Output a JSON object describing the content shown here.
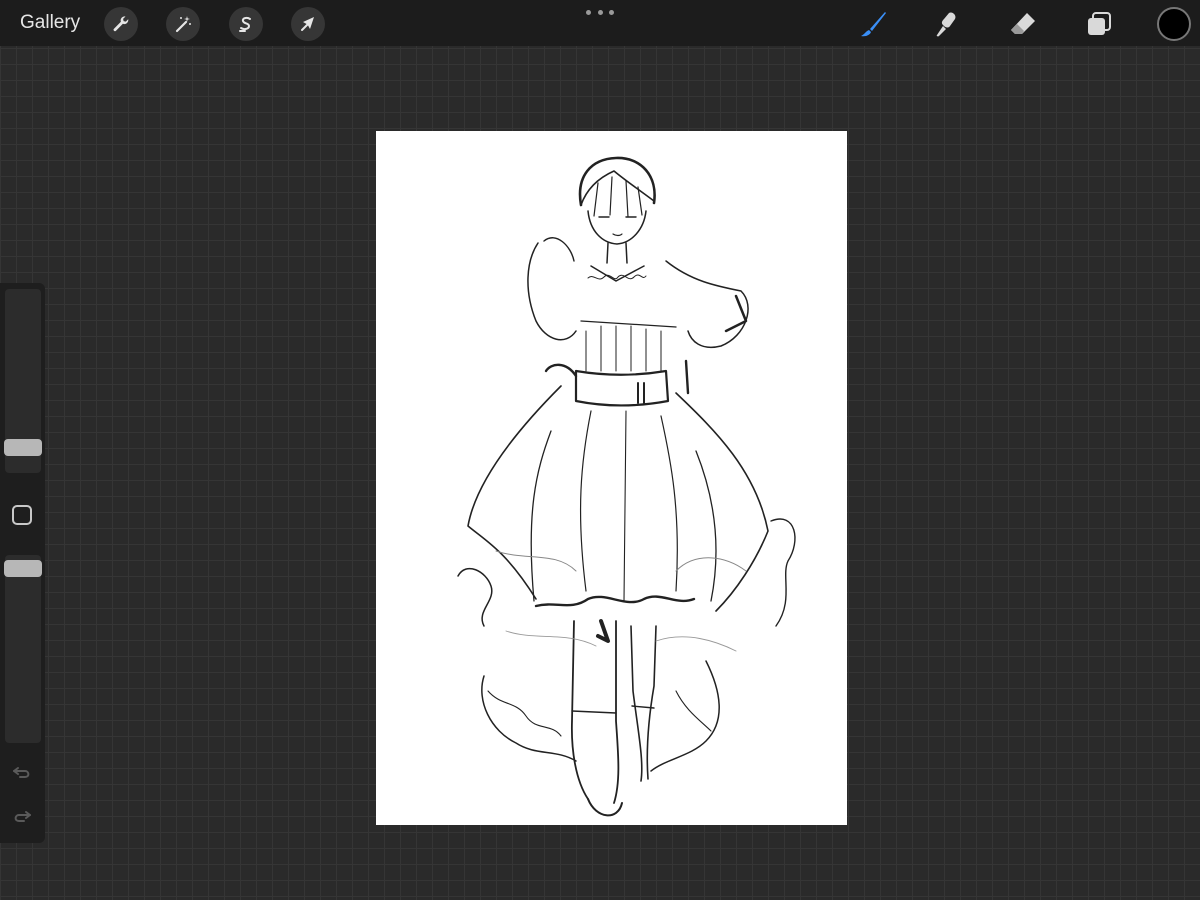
{
  "topbar": {
    "gallery_label": "Gallery",
    "left_tools": [
      "wrench-icon",
      "magic-wand-icon",
      "selection-s-icon",
      "arrow-cursor-icon"
    ],
    "right_tools": [
      "brush-icon",
      "smudge-icon",
      "eraser-icon",
      "layers-icon"
    ],
    "active_tool": "brush",
    "active_tool_color": "#3a8ff7",
    "current_color": "#000000"
  },
  "sidebar": {
    "brush_size_slider": "size",
    "opacity_slider": "opacity",
    "controls": [
      "modify-button",
      "undo-icon",
      "redo-icon"
    ]
  },
  "canvas": {
    "background": "#ffffff",
    "content": "pencil-sketch"
  }
}
